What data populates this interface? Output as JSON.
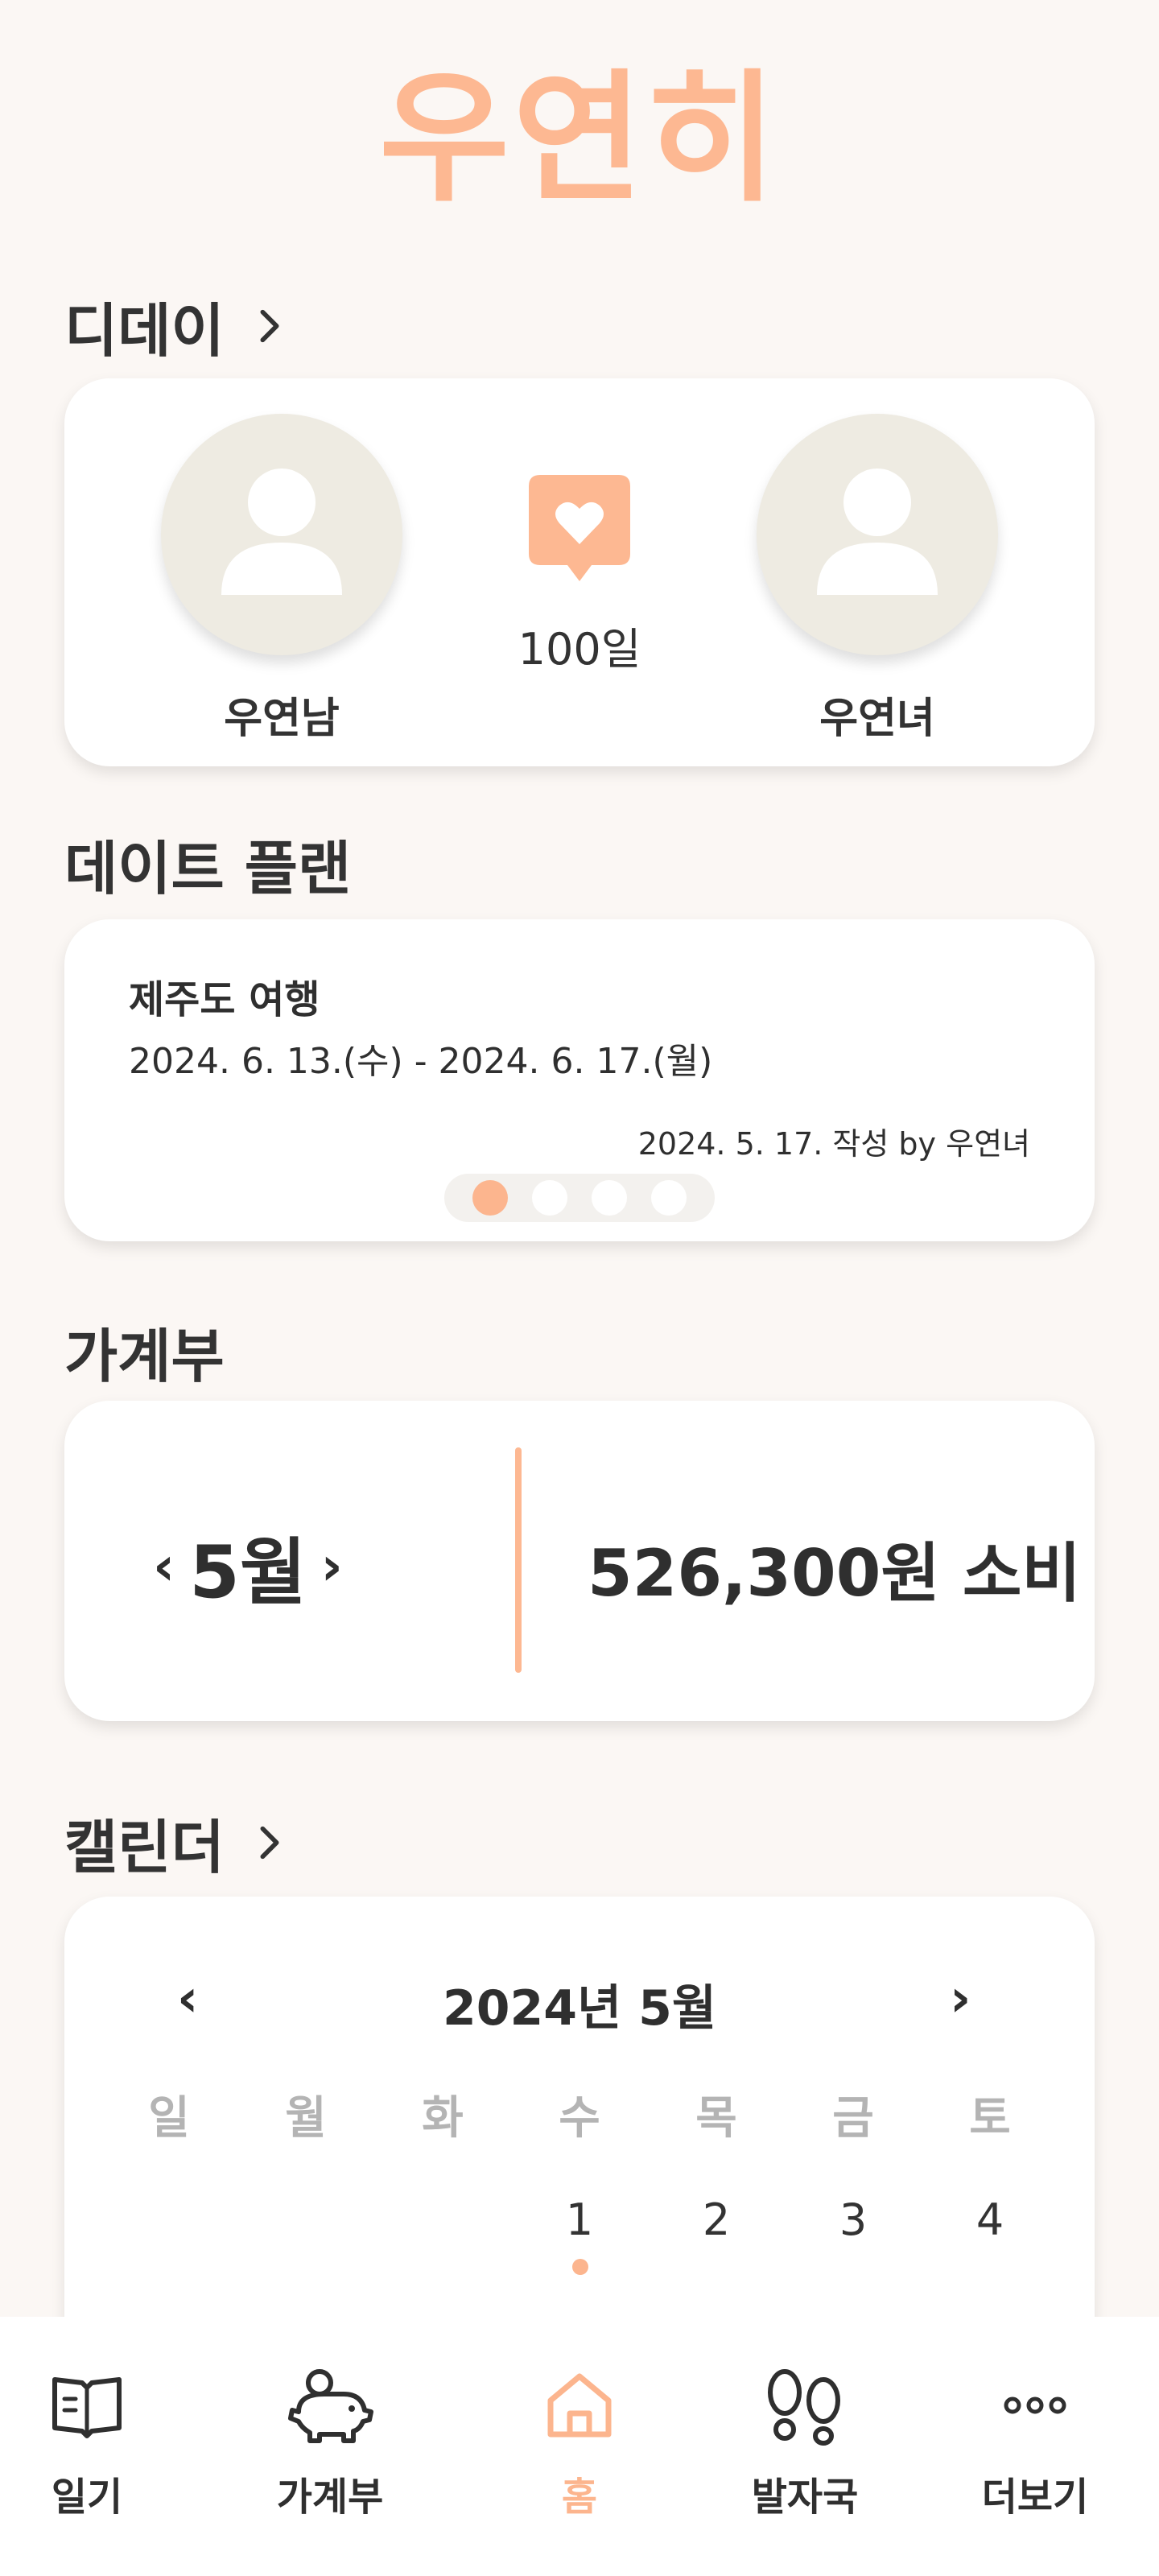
{
  "app": {
    "logo": "우연히"
  },
  "dday": {
    "title": "디데이",
    "left_name": "우연남",
    "right_name": "우연녀",
    "count": "100일",
    "accent": "#fdb892"
  },
  "plan": {
    "title": "데이트 플랜",
    "item_title": "제주도 여행",
    "item_dates": "2024. 6. 13.(수) - 2024. 6. 17.(월)",
    "item_meta": "2024. 5. 17.  작성 by  우연녀",
    "pages": 4,
    "active_page": 1
  },
  "budget": {
    "title": "가계부",
    "month": "5월",
    "prev": "‹",
    "next": "›",
    "spend": "526,300원 소비"
  },
  "calendar": {
    "title": "캘린더",
    "header": "2024년 5월",
    "prev": "‹",
    "next": "›",
    "weekdays": [
      "일",
      "월",
      "화",
      "수",
      "목",
      "금",
      "토"
    ],
    "first_row": [
      "",
      "",
      "",
      "1",
      "2",
      "3",
      "4"
    ]
  },
  "nav": {
    "items": [
      {
        "label": "일기",
        "icon": "book-icon"
      },
      {
        "label": "가계부",
        "icon": "piggy-bank-icon"
      },
      {
        "label": "홈",
        "icon": "home-icon",
        "active": true
      },
      {
        "label": "발자국",
        "icon": "footprints-icon"
      },
      {
        "label": "더보기",
        "icon": "more-icon"
      }
    ],
    "active_color": "#fcb58e"
  }
}
